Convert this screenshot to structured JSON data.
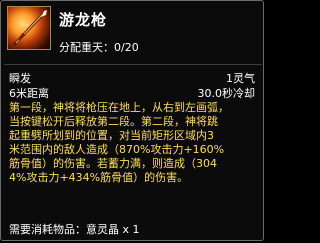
{
  "skill": {
    "name": "游龙枪",
    "points_label": "分配重天：",
    "points_value": "0/20"
  },
  "stats": {
    "cast_type": "瞬发",
    "spirit_cost": "1灵气",
    "range": "6米距离",
    "cooldown": "30.0秒冷却"
  },
  "description": [
    "第一段，神将将枪压在地上，从右到左画弧，",
    "当按键松开后释放第二段。第二段，神将跳",
    "起重劈所划到的位置，对当前矩形区域内3",
    "米范围内的敌人造成（870%攻击力+160%",
    "筋骨值）的伤害。若蓄力满，则造成（304",
    "4%攻击力+434%筋骨值）的伤害。"
  ],
  "materials": {
    "label": "需要消耗物品：",
    "item": "意灵晶 x 1"
  },
  "colors": {
    "description": "#ffdd55",
    "title": "#ffffff",
    "border": "#6b6b6b"
  }
}
